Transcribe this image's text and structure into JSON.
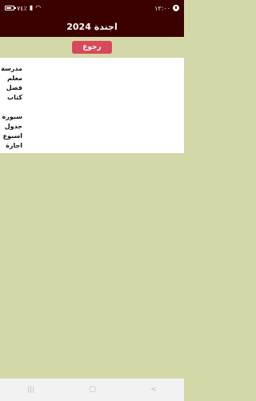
{
  "status_bar": {
    "time": "١٢:٠٠",
    "battery": "٧٤٪",
    "signal_icon": "signal-icon",
    "wifi_icon": "wifi-icon",
    "battery_level": 0.74
  },
  "app_bar": {
    "title": "اجندة 2024"
  },
  "back_button": {
    "label": "رجوع"
  },
  "menu": {
    "group1": [
      "مدرسة",
      "معلم",
      "فصل",
      "كتاب"
    ],
    "group2": [
      "سبورة",
      "جدول",
      "اسبوع",
      "اجازة"
    ]
  },
  "nav_bar": {
    "icons": [
      "menu-icon",
      "home-icon",
      "back-icon"
    ]
  },
  "colors": {
    "header": "#3b0000",
    "accent": "#d84a5b",
    "background": "#d4d8a9",
    "panel": "#ffffff"
  }
}
